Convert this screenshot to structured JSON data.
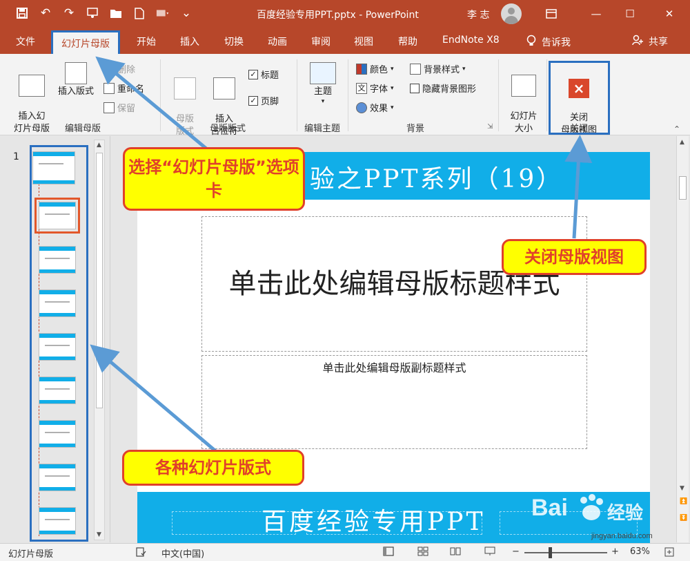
{
  "titlebar": {
    "title": "百度经验专用PPT.pptx  -  PowerPoint",
    "user": "李 志",
    "qat_icons": [
      "save-icon",
      "undo-icon",
      "redo-icon",
      "present-icon",
      "open-folder-icon",
      "new-file-icon",
      "shape-icon",
      "customize-icon"
    ]
  },
  "tabs": {
    "file": "文件",
    "slide_master": "幻灯片母版",
    "home": "开始",
    "insert": "插入",
    "transitions": "切换",
    "animations": "动画",
    "review": "审阅",
    "view": "视图",
    "help": "帮助",
    "endnote": "EndNote X8",
    "tell_me": "告诉我",
    "share": "共享"
  },
  "ribbon": {
    "edit_master": {
      "label": "编辑母版",
      "insert_slide_master": "插入幻\n灯片母版",
      "insert_layout": "插入版式",
      "delete": "删除",
      "rename": "重命名",
      "preserve": "保留"
    },
    "master_layout": {
      "label": "母版版式",
      "master_layout_btn": "母版\n版式",
      "insert_placeholder": "插入\n占位符",
      "title": "标题",
      "footers": "页脚"
    },
    "edit_theme": {
      "label": "编辑主题",
      "themes": "主题"
    },
    "background": {
      "label": "背景",
      "colors": "颜色",
      "fonts": "字体",
      "effects": "效果",
      "background_styles": "背景样式",
      "hide_background": "隐藏背景图形"
    },
    "size": {
      "label": "大小",
      "slide_size": "幻灯片\n大小"
    },
    "close": {
      "label": "关闭",
      "close_master_view": "关闭\n母版视图"
    }
  },
  "left_pane": {
    "slide_number": "1"
  },
  "slide": {
    "top_banner": "验之PPT系列（19）",
    "title_placeholder": "单击此处编辑母版标题样式",
    "subtitle_placeholder": "单击此处编辑母版副标题样式",
    "bottom_banner": "百度经验专用PPT"
  },
  "callouts": {
    "select_tab": "选择“幻灯片母版”选项卡",
    "close_view": "关闭母版视图",
    "layouts": "各种幻灯片版式"
  },
  "watermark": {
    "brand": "Bai",
    "text": "经验",
    "url": "jingyan.baidu.com"
  },
  "statusbar": {
    "view_name": "幻灯片母版",
    "language": "中文(中国)",
    "zoom": "63%"
  },
  "colors": {
    "titlebar": "#b7472a",
    "banner": "#11aee8",
    "callout_fill": "#ffff00",
    "callout_border": "#e0402a",
    "highlight_blue": "#2a6fc0"
  }
}
